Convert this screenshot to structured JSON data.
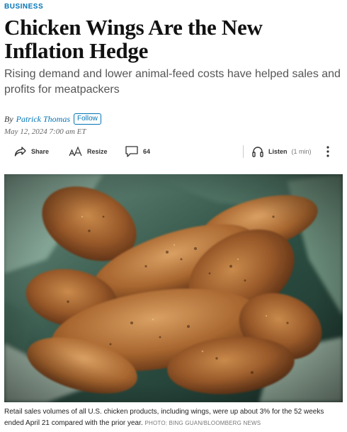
{
  "article": {
    "section": "BUSINESS",
    "headline": "Chicken Wings Are the New Inflation Hedge",
    "dek": "Rising demand and lower animal-feed costs have helped sales and profits for meatpackers",
    "byline": {
      "prefix": "By",
      "author": "Patrick Thomas",
      "follow_label": "Follow"
    },
    "timestamp": "May 12, 2024 7:00 am ET"
  },
  "toolbar": {
    "share_label": "Share",
    "resize_label": "Resize",
    "comments_count": "64",
    "listen_label": "Listen",
    "listen_duration": "(1 min)",
    "icons": [
      "share-icon",
      "resize-icon",
      "comment-icon",
      "headphones-icon",
      "more-icon"
    ]
  },
  "photo": {
    "caption": "Retail sales volumes of all U.S. chicken products, including wings, were up about 3% for the 52 weeks ended April 21 compared with the prior year.",
    "credit": "PHOTO: BING GUAN/BLOOMBERG NEWS"
  },
  "colors": {
    "accent": "#0274b6",
    "headline": "#111111",
    "dek": "#555555"
  }
}
